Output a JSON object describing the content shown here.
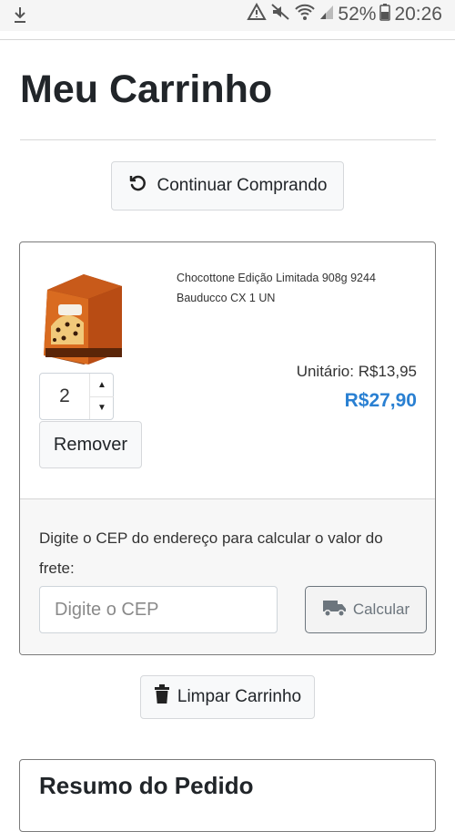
{
  "status_bar": {
    "battery": "52%",
    "time": "20:26",
    "icons": [
      "download-icon",
      "warning-icon",
      "mute-icon",
      "wifi-icon",
      "signal-icon",
      "battery-icon"
    ]
  },
  "page": {
    "title": "Meu Carrinho",
    "continue_label": "Continuar Comprando"
  },
  "cart": {
    "item": {
      "name": "Chocottone Edição Limitada 908g 9244 Bauducco CX 1 UN",
      "unit_price": "Unitário: R$13,95",
      "total_price": "R$27,90",
      "quantity": "2",
      "remove_label": "Remover",
      "image_text": "CHOCOTTONE"
    },
    "shipping": {
      "label": "Digite o CEP do endereço para calcular o valor do frete:",
      "placeholder": "Digite o CEP",
      "calc_label": "Calcular"
    },
    "clear_label": "Limpar Carrinho"
  },
  "summary": {
    "title": "Resumo do Pedido"
  },
  "colors": {
    "price_blue": "#2a80d2",
    "border": "#7b7b7b"
  }
}
